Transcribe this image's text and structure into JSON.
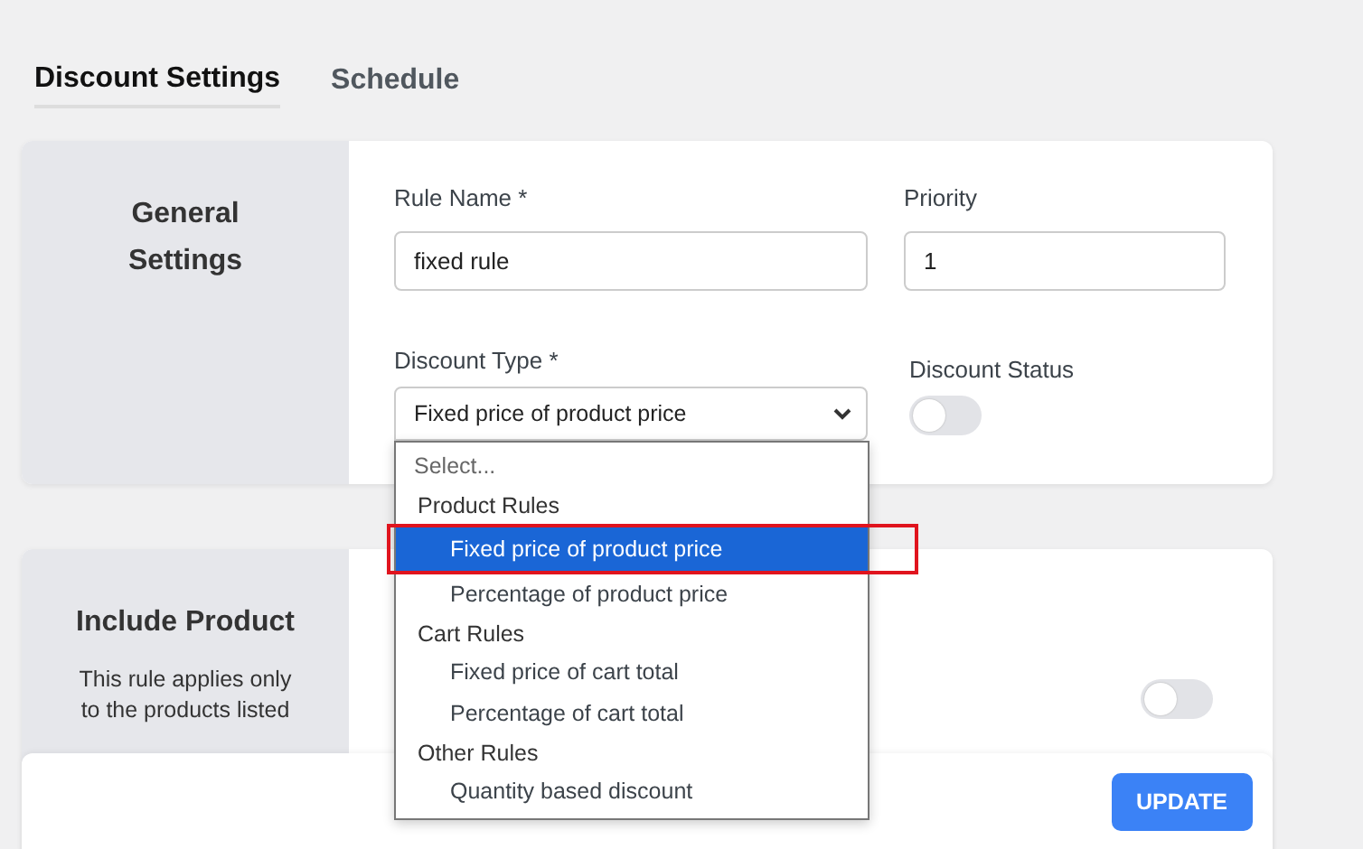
{
  "tabs": [
    {
      "label": "Discount Settings",
      "selected": true
    },
    {
      "label": "Schedule",
      "selected": false
    }
  ],
  "general": {
    "title": "General Settings",
    "rule_name": {
      "label": "Rule Name *",
      "value": "fixed rule"
    },
    "priority": {
      "label": "Priority",
      "value": "1"
    },
    "discount_type": {
      "label": "Discount Type *",
      "value": "Fixed price of product price",
      "expanded": true
    },
    "discount_status": {
      "label": "Discount Status",
      "on": false
    }
  },
  "dropdown": [
    {
      "kind": "placeholder",
      "label": "Select...",
      "selected": false
    },
    {
      "kind": "group",
      "label": "Product Rules",
      "selected": false
    },
    {
      "kind": "option",
      "label": "Fixed price of product price",
      "selected": true
    },
    {
      "kind": "option",
      "label": "Percentage of product price",
      "selected": false
    },
    {
      "kind": "group",
      "label": "Cart Rules",
      "selected": false
    },
    {
      "kind": "option",
      "label": "Fixed price of cart total",
      "selected": false
    },
    {
      "kind": "option",
      "label": "Percentage of cart total",
      "selected": false
    },
    {
      "kind": "group",
      "label": "Other Rules",
      "selected": false
    },
    {
      "kind": "option",
      "label": "Quantity based discount",
      "selected": false
    }
  ],
  "include_product": {
    "title": "Include Product",
    "description": "This rule applies only to the products listed",
    "on": false
  },
  "footer": {
    "button": "UPDATE"
  }
}
